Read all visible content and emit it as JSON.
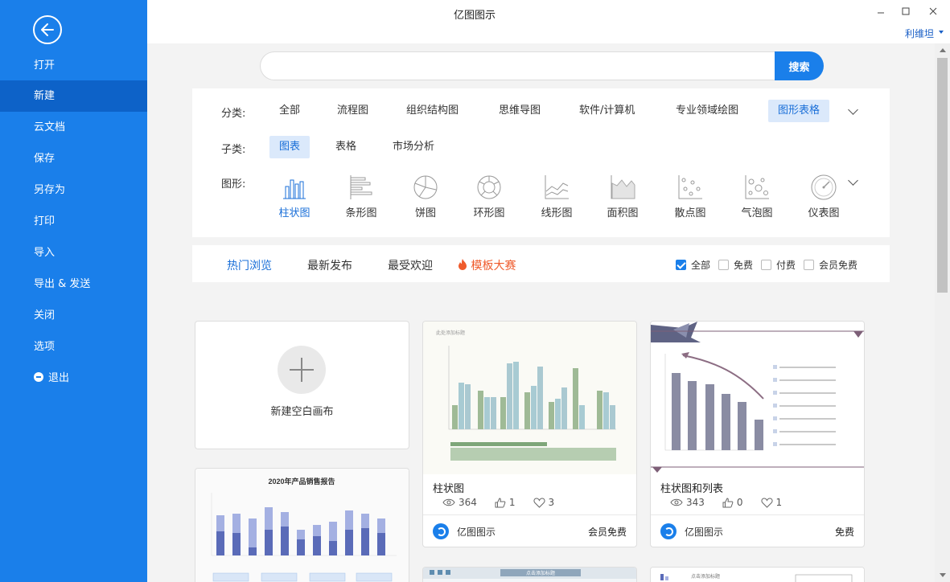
{
  "window": {
    "title": "亿图图示",
    "user": "利维坦"
  },
  "sidebar": {
    "items": [
      {
        "label": "打开"
      },
      {
        "label": "新建"
      },
      {
        "label": "云文档"
      },
      {
        "label": "保存"
      },
      {
        "label": "另存为"
      },
      {
        "label": "打印"
      },
      {
        "label": "导入"
      },
      {
        "label": "导出 & 发送"
      },
      {
        "label": "关闭"
      },
      {
        "label": "选项"
      },
      {
        "label": "退出"
      }
    ],
    "active_index": 1
  },
  "search": {
    "placeholder": "",
    "button": "搜索"
  },
  "filters": {
    "category_label": "分类:",
    "categories": [
      "全部",
      "流程图",
      "组织结构图",
      "思维导图",
      "软件/计算机",
      "专业领域绘图",
      "图形表格"
    ],
    "category_active": "图形表格",
    "subcategory_label": "子类:",
    "subcategories": [
      "图表",
      "表格",
      "市场分析"
    ],
    "subcategory_active": "图表",
    "shape_label": "图形:",
    "shapes": [
      "柱状图",
      "条形图",
      "饼图",
      "环形图",
      "线形图",
      "面积图",
      "散点图",
      "气泡图",
      "仪表图"
    ],
    "shape_active": "柱状图"
  },
  "tabs": {
    "items": [
      "热门浏览",
      "最新发布",
      "最受欢迎",
      "模板大赛"
    ],
    "active": "热门浏览",
    "checks": [
      {
        "label": "全部",
        "checked": true
      },
      {
        "label": "免费",
        "checked": false
      },
      {
        "label": "付费",
        "checked": false
      },
      {
        "label": "会员免费",
        "checked": false
      }
    ]
  },
  "new_card": {
    "label": "新建空白画布"
  },
  "templates": [
    {
      "name": "柱状图",
      "views": "364",
      "likes": "1",
      "favs": "3",
      "author": "亿图图示",
      "price": "会员免费"
    },
    {
      "name": "柱状图和列表",
      "views": "343",
      "likes": "0",
      "favs": "1",
      "author": "亿图图示",
      "price": "免费"
    }
  ],
  "thumb_texts": {
    "card1_title": "此处添加标题",
    "card3_title": "2020年产品销售报告",
    "card4_title": "点击添加标题",
    "card5_title": "点击添加标题"
  },
  "colors": {
    "accent": "#1a7fea",
    "sidebar_active": "#0d62c8",
    "hot": "#ef5b2c"
  }
}
